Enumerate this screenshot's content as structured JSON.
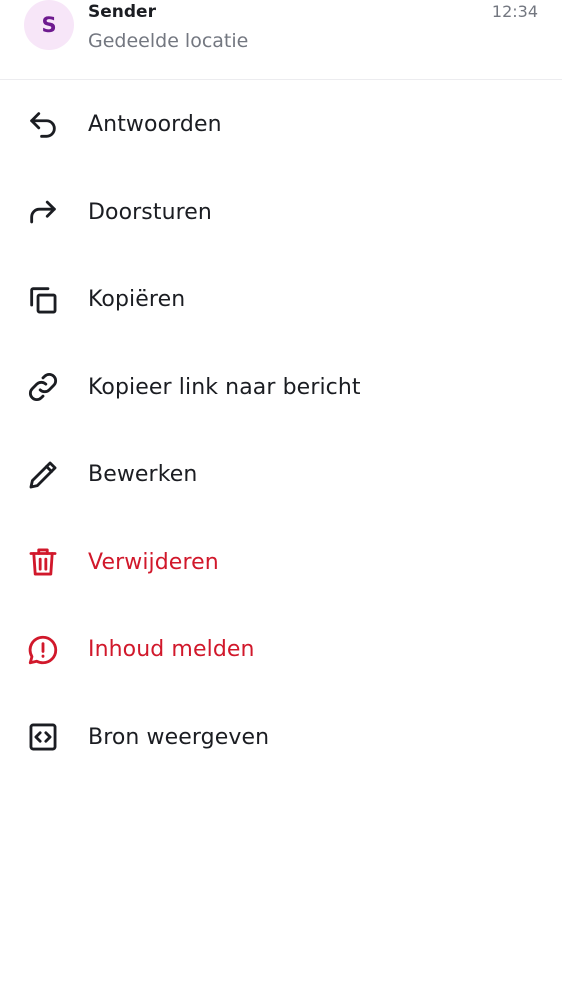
{
  "header": {
    "avatar_letter": "S",
    "sender_name": "Sender",
    "subtitle": "Gedeelde locatie",
    "time": "12:34"
  },
  "colors": {
    "danger": "#d1182b",
    "avatar_bg": "#f7e6f8",
    "avatar_text": "#6e1a8f"
  },
  "menu": {
    "items": [
      {
        "label": "Antwoorden",
        "icon": "reply-icon"
      },
      {
        "label": "Doorsturen",
        "icon": "forward-icon"
      },
      {
        "label": "Kopiëren",
        "icon": "copy-icon"
      },
      {
        "label": "Kopieer link naar bericht",
        "icon": "link-icon"
      },
      {
        "label": "Bewerken",
        "icon": "pencil-icon"
      },
      {
        "label": "Verwijderen",
        "icon": "trash-icon"
      },
      {
        "label": "Inhoud melden",
        "icon": "report-icon"
      },
      {
        "label": "Bron weergeven",
        "icon": "code-icon"
      }
    ]
  }
}
